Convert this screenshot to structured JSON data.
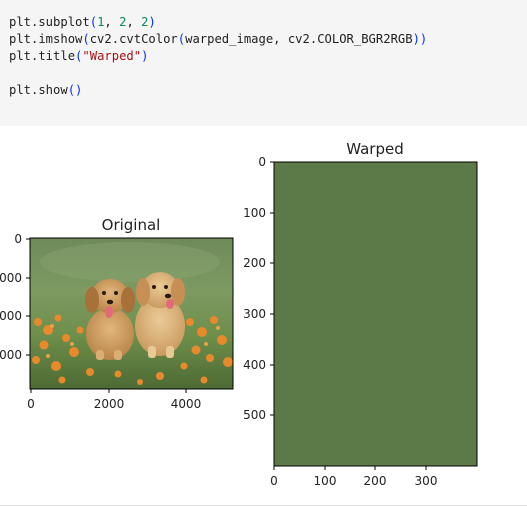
{
  "code_cell": {
    "lines": [
      [
        {
          "t": "plt.subplot",
          "c": "plain"
        },
        {
          "t": "(",
          "c": "paren"
        },
        {
          "t": "1",
          "c": "num"
        },
        {
          "t": ", ",
          "c": "plain"
        },
        {
          "t": "2",
          "c": "num"
        },
        {
          "t": ", ",
          "c": "plain"
        },
        {
          "t": "2",
          "c": "num"
        },
        {
          "t": ")",
          "c": "paren"
        }
      ],
      [
        {
          "t": "plt.imshow",
          "c": "plain"
        },
        {
          "t": "(",
          "c": "paren"
        },
        {
          "t": "cv2.cvtColor",
          "c": "plain"
        },
        {
          "t": "(",
          "c": "paren"
        },
        {
          "t": "warped_image, cv2.COLOR_BGR2RGB",
          "c": "plain"
        },
        {
          "t": "))",
          "c": "paren"
        }
      ],
      [
        {
          "t": "plt.title",
          "c": "plain"
        },
        {
          "t": "(",
          "c": "paren"
        },
        {
          "t": "\"Warped\"",
          "c": "str"
        },
        {
          "t": ")",
          "c": "paren"
        }
      ],
      [],
      [
        {
          "t": "plt.show",
          "c": "plain"
        },
        {
          "t": "()",
          "c": "paren"
        }
      ]
    ]
  },
  "figure": {
    "subplots": [
      {
        "title": "Original",
        "content": "photo of two golden retriever puppies sitting in green grass with orange flowers",
        "x_ticks": [
          "0",
          "2000",
          "4000"
        ],
        "y_ticks": [
          "0",
          "000",
          "000",
          "000"
        ]
      },
      {
        "title": "Warped",
        "content": "uniform dark green image",
        "fill_color": "#5b7a47",
        "x_ticks": [
          "0",
          "100",
          "200",
          "300"
        ],
        "y_ticks": [
          "0",
          "100",
          "200",
          "300",
          "400",
          "500"
        ]
      }
    ]
  },
  "chart_data": [
    {
      "type": "image",
      "title": "Original",
      "xlim": [
        0,
        5200
      ],
      "ylim": [
        2900,
        0
      ],
      "x_ticks": [
        0,
        2000,
        4000
      ],
      "y_ticks_visible_labels": [
        "0",
        "000",
        "000",
        "000"
      ]
    },
    {
      "type": "image",
      "title": "Warped",
      "xlim": [
        0,
        400
      ],
      "ylim": [
        600,
        0
      ],
      "x_ticks": [
        0,
        100,
        200,
        300
      ],
      "y_ticks": [
        0,
        100,
        200,
        300,
        400,
        500
      ]
    }
  ],
  "colors": {
    "code_background": "#f5f5f5",
    "number": "#09885a",
    "string": "#a31515",
    "paren": "#0431fa",
    "warped_fill": "#5b7a47"
  }
}
